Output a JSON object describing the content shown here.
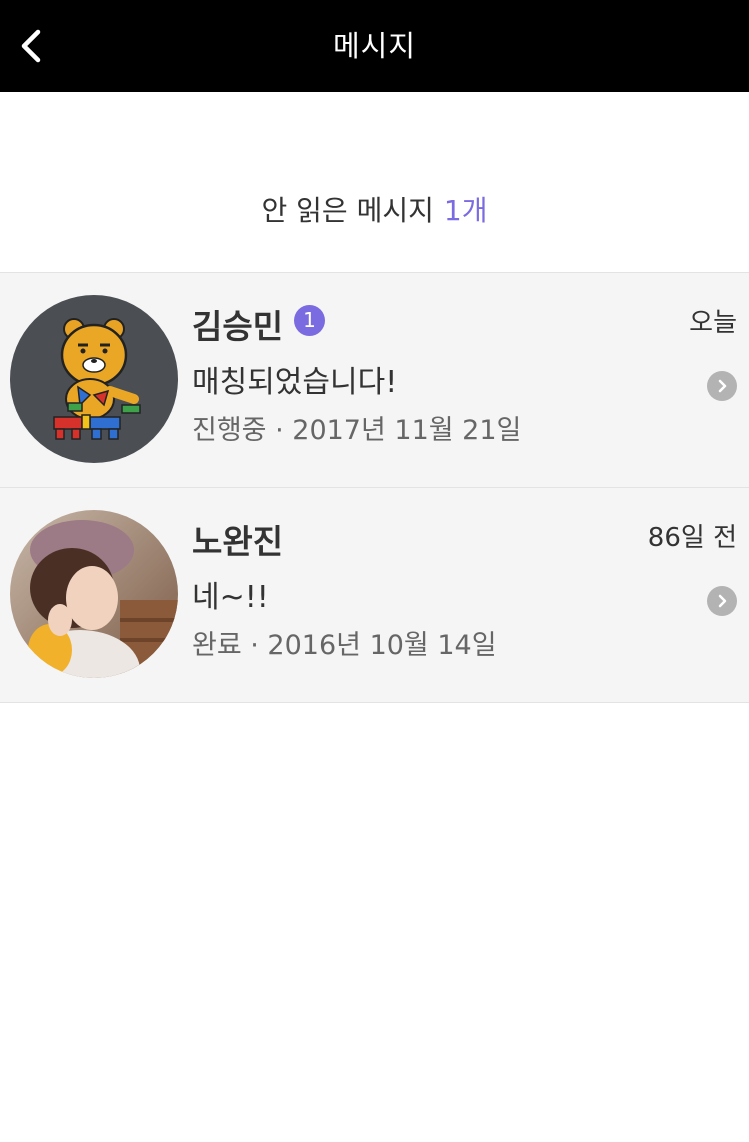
{
  "header": {
    "title": "메시지",
    "back_icon": "chevron-left-icon"
  },
  "summary": {
    "label": "안 읽은 메시지",
    "count": "1개"
  },
  "conversations": [
    {
      "name": "김승민",
      "unread_badge": "1",
      "time": "오늘",
      "message": "매칭되었습니다!",
      "status": "진행중 · 2017년 11월 21일",
      "avatar_icon": "lion-character-avatar"
    },
    {
      "name": "노완진",
      "time": "86일 전",
      "message": "네~!!",
      "status": "완료 · 2016년 10월 14일",
      "avatar_icon": "user-photo-avatar"
    }
  ],
  "colors": {
    "header_bg": "#000000",
    "accent": "#7b6be0",
    "row_bg": "#f5f5f5"
  }
}
